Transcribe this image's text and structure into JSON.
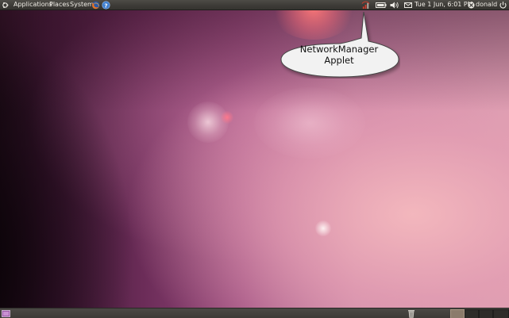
{
  "top_panel": {
    "menus": {
      "applications": "Applications",
      "places": "Places",
      "system": "System"
    },
    "launchers": [
      "firefox-icon",
      "help-icon"
    ],
    "indicators": [
      "network-icon",
      "battery-icon",
      "volume-icon",
      "mail-icon"
    ],
    "clock": "Tue  1 Jun,  6:01 PM",
    "user": "donald",
    "icons": {
      "logo": "ubuntu-logo-icon",
      "user": "user-icon",
      "power": "power-icon"
    }
  },
  "callout": {
    "line1": "NetworkManager",
    "line2": "Applet"
  },
  "bottom_panel": {
    "icons": [
      "show-desktop-icon",
      "trash-icon"
    ],
    "workspaces": 4,
    "active_workspace": 1
  },
  "colors": {
    "panel": "#3e3c38",
    "panel_text": "#f0ede6",
    "wallpaper_dark": "#1a0b14",
    "wallpaper_mid": "#9a4a7e",
    "wallpaper_light": "#d99cb0",
    "callout_fill": "#f2f2f2"
  }
}
